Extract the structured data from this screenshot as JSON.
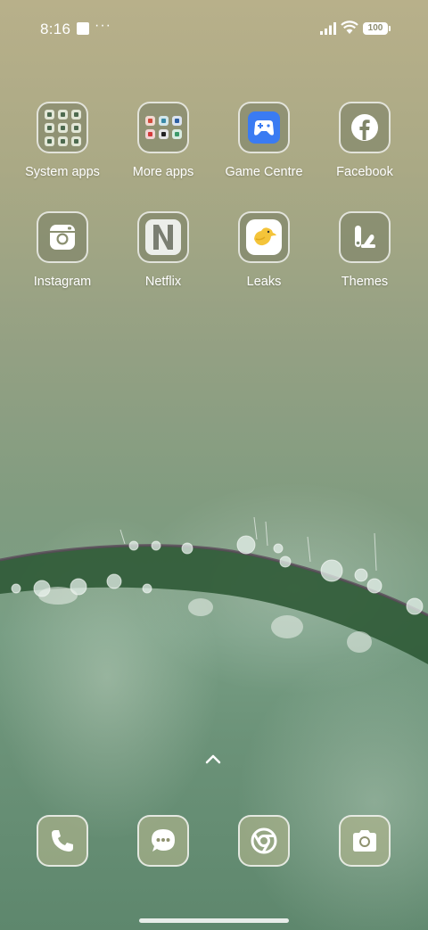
{
  "status_bar": {
    "time": "8:16",
    "more_indicator": "···",
    "battery_level": "100",
    "icons": [
      "notification-square-icon",
      "signal-icon",
      "wifi-icon",
      "battery-icon"
    ]
  },
  "home_apps": [
    {
      "label": "System apps",
      "icon": "folder-icon"
    },
    {
      "label": "More apps",
      "icon": "folder-icon"
    },
    {
      "label": "Game Centre",
      "icon": "game-controller-icon"
    },
    {
      "label": "Facebook",
      "icon": "facebook-icon"
    },
    {
      "label": "Instagram",
      "icon": "camera-icon"
    },
    {
      "label": "Netflix",
      "icon": "netflix-icon"
    },
    {
      "label": "Leaks",
      "icon": "bird-icon"
    },
    {
      "label": "Themes",
      "icon": "themes-icon"
    }
  ],
  "dock": [
    {
      "name": "Phone",
      "icon": "phone-icon"
    },
    {
      "name": "Messages",
      "icon": "message-icon"
    },
    {
      "name": "Chrome",
      "icon": "chrome-icon"
    },
    {
      "name": "Camera",
      "icon": "camera-icon"
    }
  ],
  "colors": {
    "game_centre_blue": "#3a7bf2",
    "leaks_yellow": "#f4c43a"
  }
}
